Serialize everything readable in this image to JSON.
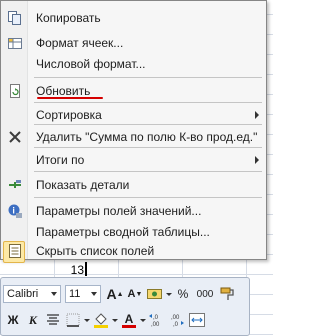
{
  "menu": {
    "items": [
      {
        "label": "Копировать",
        "icon": "copy-icon"
      },
      {
        "label": "Формат ячеек...",
        "icon": "format-cells-icon"
      },
      {
        "label": "Числовой формат...",
        "icon": ""
      },
      {
        "label": "Обновить",
        "icon": "refresh-icon"
      },
      {
        "label": "Сортировка",
        "icon": "",
        "submenu": true
      },
      {
        "label": "Удалить \"Сумма по полю К-во прод.ед.\"",
        "icon": "delete-x-icon"
      },
      {
        "label": "Итоги по",
        "icon": "",
        "submenu": true
      },
      {
        "label": "Показать детали",
        "icon": "show-details-icon"
      },
      {
        "label": "Параметры полей значений...",
        "icon": "field-settings-icon"
      },
      {
        "label": "Параметры сводной таблицы...",
        "icon": ""
      },
      {
        "label": "Скрыть список полей",
        "icon": "field-list-icon"
      }
    ]
  },
  "sheet": {
    "cell_value": "13"
  },
  "toolbar": {
    "font_name": "Calibri",
    "font_size": "11",
    "grow_font": "A",
    "shrink_font": "A",
    "percent": "%",
    "thousands": "000",
    "bold": "Ж",
    "italic": "К",
    "font_color_letter": "A",
    "font_color": "#d50000"
  }
}
